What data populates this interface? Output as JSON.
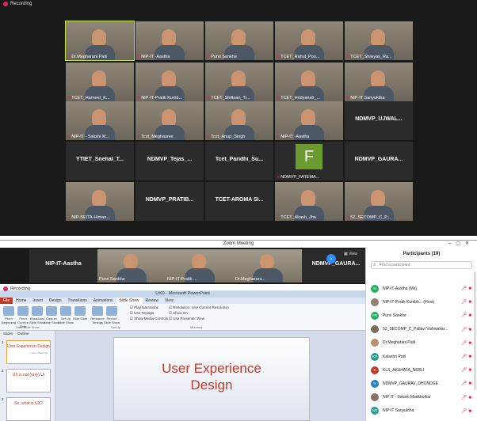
{
  "top_recording": "Recording",
  "gallery": [
    {
      "name": "Dr.Megharani Patil",
      "type": "video",
      "active": true
    },
    {
      "name": "NIP-IT -Aastha",
      "type": "video"
    },
    {
      "name": "Purvi Sankhe",
      "type": "video"
    },
    {
      "name": "TCET_Rahul_Poo...",
      "type": "video"
    },
    {
      "name": "TCET_Shreyas_Ra...",
      "type": "video"
    },
    {
      "name": "TCET_Harneet_K...",
      "type": "video"
    },
    {
      "name": "NIP-IT-Pratik Kumb...",
      "type": "video"
    },
    {
      "name": "TCET_Shiltoan_Ti...",
      "type": "video"
    },
    {
      "name": "TCET_Hridyansh_...",
      "type": "video"
    },
    {
      "name": "NIP-IT Sanyuktha",
      "type": "video"
    },
    {
      "name": "NIP-IT - Sakshi M...",
      "type": "video"
    },
    {
      "name": "Tcet_Meghasree",
      "type": "video"
    },
    {
      "name": "Tcet_Anup_Singh",
      "type": "video"
    },
    {
      "name": "NIP-IT -Aastha",
      "type": "video"
    },
    {
      "name": "NDMVP_UJWAL...",
      "type": "name"
    },
    {
      "name": "YTIET_Snehal_T...",
      "type": "name"
    },
    {
      "name": "NDMVP_Tejas_...",
      "type": "name"
    },
    {
      "name": "Tcet_Paridhi_Su...",
      "type": "name"
    },
    {
      "name": "NDMVP_FATEMA...",
      "type": "letter",
      "letter": "F"
    },
    {
      "name": "NDMVP_GAURA...",
      "type": "name"
    },
    {
      "name": "NIP-SEITA-Himan...",
      "type": "video"
    },
    {
      "name": "NDMVP_PRATIB...",
      "type": "name"
    },
    {
      "name": "TCET-AROMA SI...",
      "type": "name"
    },
    {
      "name": "TCET_Akash_Jha",
      "type": "video"
    },
    {
      "name": "52_SECOMP_C_P...",
      "type": "video"
    }
  ],
  "zoom_window": {
    "title": "Zoom Meeting",
    "strip": [
      {
        "name": "NIP-IT-Aastha",
        "type": "name"
      },
      {
        "name": "Purvi Sankhe",
        "type": "video"
      },
      {
        "name": "NIP-IT-Pratik ...",
        "type": "video"
      },
      {
        "name": "Dr.Megharani...",
        "type": "video"
      },
      {
        "name": "NDMVP_GAURA...",
        "type": "name"
      }
    ],
    "view_label": "View",
    "recording": "Recording"
  },
  "powerpoint": {
    "title": "UXD - Microsoft PowerPoint",
    "tabs": [
      "File",
      "Home",
      "Insert",
      "Design",
      "Transitions",
      "Animations",
      "Slide Show",
      "Review",
      "View"
    ],
    "selected_tab": "Slide Show",
    "ribbon_buttons": [
      "From Beginning",
      "From Current Slide",
      "Broadcast Slide Show",
      "Custom Slide Show",
      "Set Up Slide Show",
      "Hide Slide",
      "Rehearse Timings",
      "Record Slide Show"
    ],
    "ribbon_checks": [
      "Play Narrations",
      "Use Timings",
      "Show Media Controls",
      "Resolution: Use Current Resolution",
      "Show On:",
      "Use Presenter View"
    ],
    "ribbon_groups": [
      "Start Slide Show",
      "Set Up",
      "Monitors"
    ],
    "pane_tabs": [
      "Slides",
      "Outline"
    ],
    "thumbnails": [
      {
        "num": "1",
        "title": "User Experience Design",
        "sub": "— Ketan Bachhav"
      },
      {
        "num": "2",
        "title": "UX is not (only) UI",
        "sub": ""
      },
      {
        "num": "3",
        "title": "So, what is UX?",
        "sub": ""
      }
    ],
    "slide_title_line1": "User Experience",
    "slide_title_line2": "Design"
  },
  "participants": {
    "title": "Participants (19)",
    "search_placeholder": "Find a participant",
    "list": [
      {
        "initials": "N",
        "name": "NIP-IT-Aastha (Me)",
        "color": "#27ae60"
      },
      {
        "initials": "",
        "name": "NIP-IT-Pratik Kumbh... (Host)",
        "color": "#8e7f6e"
      },
      {
        "initials": "PS",
        "name": "Purvi Sankhe",
        "color": "#27ae60"
      },
      {
        "initials": "",
        "name": "52_SECOMP_C_Pallavi Vishwakar...",
        "color": "#7a6a5a"
      },
      {
        "initials": "",
        "name": "Dr.Megharani Patil",
        "color": "#b59070"
      },
      {
        "initials": "KP",
        "name": "Kalashri Patil",
        "color": "#2a9d8f"
      },
      {
        "initials": "K",
        "name": "KLS_AKSHATA_NERLI",
        "color": "#c0392b"
      },
      {
        "initials": "N",
        "name": "NDMVP_GAURAV_DHONDGE",
        "color": "#2980b9"
      },
      {
        "initials": "",
        "name": "NIP IT - Sakshi Madkholkar",
        "color": "#8b6f5f"
      },
      {
        "initials": "NS",
        "name": "NIP-IT Sanyuktha",
        "color": "#2a9d8f"
      }
    ]
  }
}
